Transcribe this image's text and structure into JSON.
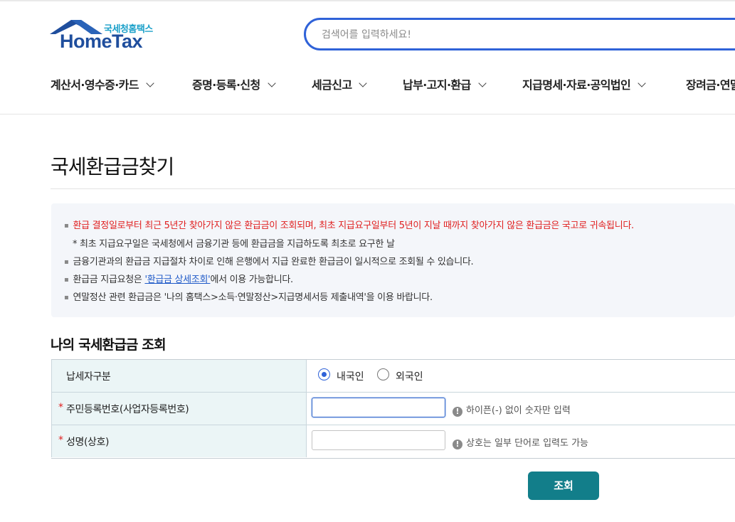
{
  "header": {
    "logo_sub": "국세청홈택스",
    "logo_main": "HomeTax",
    "search_placeholder": "검색어를 입력하세요!",
    "nav": [
      {
        "label": "계산서·영수증·카드"
      },
      {
        "label": "증명·등록·신청"
      },
      {
        "label": "세금신고"
      },
      {
        "label": "납부·고지·환급"
      },
      {
        "label": "지급명세·자료·공익법인"
      },
      {
        "label": "장려금·연말"
      }
    ]
  },
  "page": {
    "title": "국세환급금찾기"
  },
  "notice": {
    "line1": "환급 결정일로부터 최근 5년간 찾아가지 않은 환급금이 조회되며, 최초 지급요구일부터 5년이 지날 때까지 찾아가지 않은 환급금은 국고로 귀속됩니다.",
    "line1_sub": "* 최초 지급요구일은 국세청에서 금융기관 등에 환급금을 지급하도록 최초로 요구한 날",
    "line2": "금융기관과의 환급금 지급절차 차이로 인해 은행에서 지급 완료한 환급금이 일시적으로 조회될 수 있습니다.",
    "line3_prefix": "환급금 지급요청은 ",
    "line3_link": "'환급금 상세조회'",
    "line3_suffix": "에서 이용 가능합니다.",
    "line4": "연말정산 관련 환급금은 '나의 홈택스>소득·연말정산>지급명세서등 제출내역'을 이용 바랍니다."
  },
  "form": {
    "section_title": "나의 국세환급금 조회",
    "taxpayer_type_label": "납세자구분",
    "radio_domestic": "내국인",
    "radio_foreign": "외국인",
    "selected": "내국인",
    "rrn_label": "주민등록번호(사업자등록번호)",
    "rrn_value": "",
    "rrn_hint": "하이픈(-) 없이 숫자만 입력",
    "name_label": "성명(상호)",
    "name_value": "",
    "name_hint": "상호는 일부 단어로 입력도 가능",
    "required_mark": "*",
    "hint_icon": "!",
    "submit_label": "조회"
  },
  "colors": {
    "brand_blue": "#1f4e9d",
    "accent_blue": "#2f62d8",
    "warning_red": "#e02020",
    "button_teal": "#127e8a",
    "table_header_bg": "#ebf5f6"
  }
}
